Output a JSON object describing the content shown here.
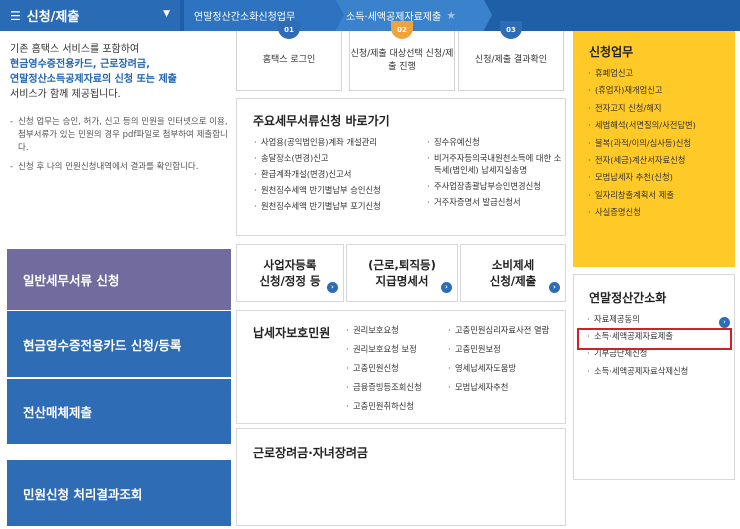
{
  "nav": {
    "main_label": "신청/제출",
    "crumb1": "연말정산간소화신청업무",
    "crumb2": "소득·세액공제자료제출"
  },
  "intro": {
    "line1": "기존 홈택스 서비스를 포함하여",
    "line2": "현금영수증전용카드, 근로장려금,",
    "line3_hl": "연말정산소득공제자료",
    "line3_rest": "의 신청 또는 제출",
    "line4": "서비스가 함께 제공됩니다.",
    "bullet1": "신청 업무는 승인, 허가, 신고 등의 민원을 인터넷으로 이용, 첨부서류가 있는 민원의 경우 pdf파일로 첨부하여 제출합니다.",
    "bullet2": "신청 후 나의 민원신청내역에서 결과를 확인합니다."
  },
  "left_buttons": [
    "일반세무서류 신청",
    "현금영수증전용카드 신청/등록",
    "전산매체제출",
    "민원신청 처리결과조회"
  ],
  "login_steps": [
    {
      "num": "01",
      "label": "홈택스 로그인"
    },
    {
      "num": "02",
      "label": "신청/제출 대상선택 신청/제출 진행"
    },
    {
      "num": "03",
      "label": "신청/제출 결과확인"
    }
  ],
  "shortcut": {
    "title": "주요세무서류신청 바로가기",
    "col1": [
      "사업용(공익법인용)계좌 개설관리",
      "송달장소(변경)신고",
      "환급계좌개설(변경)신고서",
      "원천징수세액 반기별납부 승인신청",
      "원천징수세액 반기별납부 포기신청"
    ],
    "col2": [
      "징수유예신청",
      "비거주자등의국내원천소득에 대한 소득세(법인세) 납세지실송명",
      "주사업장총괄납부승인변경신청",
      "거주자증명서 발급신청서"
    ]
  },
  "trio": [
    {
      "line1": "사업자등록",
      "line2": "신청/정정 등"
    },
    {
      "line1": "(근로,퇴직등)",
      "line2": "지급명세서"
    },
    {
      "line1": "소비제세",
      "line2": "신청/제출"
    }
  ],
  "taxpayer": {
    "title": "납세자보호민원",
    "col1": [
      "권리보호요청",
      "권리보호요청 보정",
      "고충민원신청",
      "금융증빙등조회신청",
      "고충민원취하신청"
    ],
    "col2": [
      "고충민원심리자료사전 열람",
      "고충민원보정",
      "영세납세자도움방",
      "모범납세자추천"
    ]
  },
  "work_title": "근로장려금·자녀장려금",
  "apply": {
    "title": "신청업무",
    "items": [
      "휴폐업신고",
      "(휴업자)재개업신고",
      "전자고지 신청/해지",
      "세법해석(서면질의/사전답변)",
      "불복(과적/이의/심사등)신청",
      "전자(세금)계산서자료신청",
      "모범납세자 추천(신청)",
      "일자리창출계획서 제출",
      "사실증명신청"
    ]
  },
  "yearend": {
    "title": "연말정산간소화",
    "items": [
      "자료제공동의",
      "소득·세액공제자료제출",
      "기부금단체신청",
      "소득·세액공제자료삭제신청"
    ]
  },
  "colors": {
    "nav": "#1f5fa8",
    "accent_yellow": "#ffc928",
    "button_blue": "#2f6cb6",
    "button_purple": "#716b9e",
    "highlight_red": "#d2202b"
  }
}
